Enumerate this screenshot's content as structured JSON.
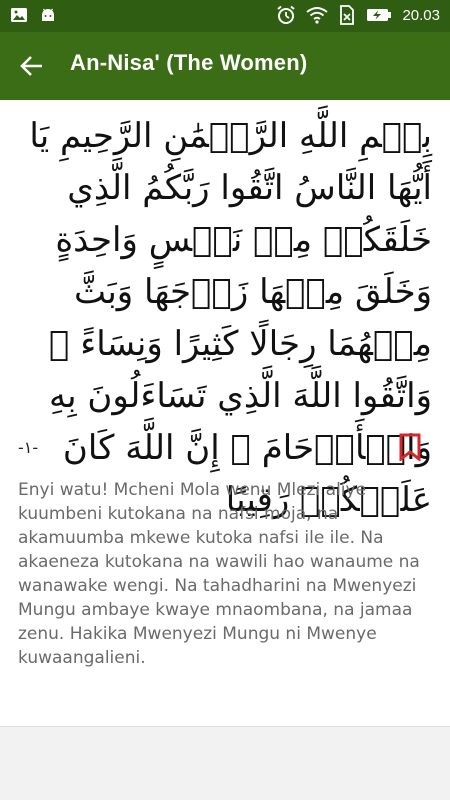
{
  "status_bar": {
    "time": "20.03",
    "icons": [
      "image-icon",
      "android-icon",
      "alarm-icon",
      "wifi-icon",
      "sim-off-icon",
      "battery-charging-icon"
    ]
  },
  "app_bar": {
    "title": "An-Nisa' (The Women)",
    "back_icon": "arrow-left-icon"
  },
  "verse": {
    "arabic": "بِسۡمِ اللَّهِ الرَّحۡمَٰنِ الرَّحِيمِ يَا أَيُّهَا النَّاسُ اتَّقُوا رَبَّكُمُ الَّذِي خَلَقَكُمۡ مِنۡ نَفۡسٍ وَاحِدَةٍ وَخَلَقَ مِنۡهَا زَوۡجَهَا وَبَثَّ مِنۡهُمَا رِجَالًا كَثِيرًا وَنِسَاءً ۚ وَاتَّقُوا اللَّهَ الَّذِي تَسَاءَلُونَ بِهِ وَالۡأَرۡحَامَ ۚ إِنَّ اللَّهَ كَانَ عَلَيۡكُمۡ رَقِيبًا",
    "number": "-١-",
    "translation": "Enyi watu! Mcheni Mola wenu Mlezi aliye kuumbeni kutokana na nafsi moja, na akamuumba mkewe kutoka nafsi ile ile. Na akaeneza kutokana na wawili hao wanaume na wanawake wengi. Na tahadharini na Mwenyezi Mungu ambaye kwaye mnaombana, na jamaa zenu. Hakika Mwenyezi Mungu ni Mwenye kuwaangalieni.",
    "bookmark_color": "#d9252a"
  },
  "colors": {
    "status_bar": "#2f5e12",
    "app_bar": "#3a6d16"
  }
}
